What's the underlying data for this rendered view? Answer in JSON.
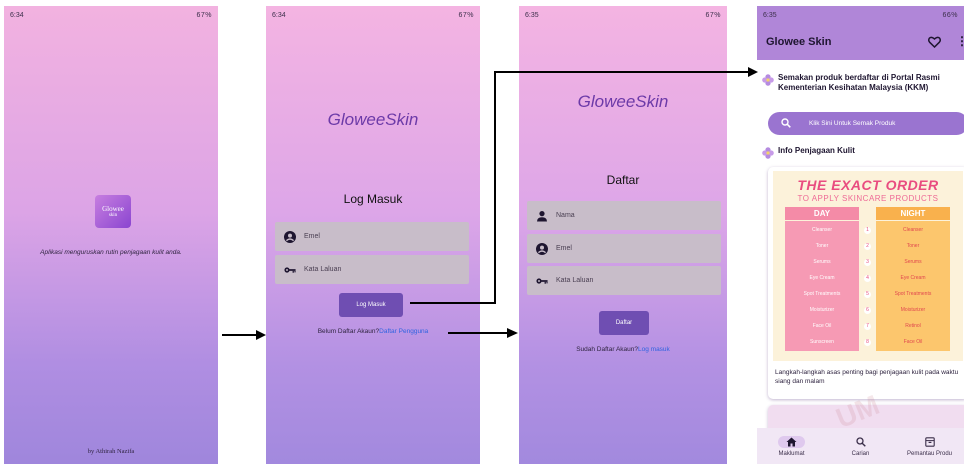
{
  "status": {
    "screen1": {
      "time": "6:34",
      "right": "67%"
    },
    "screen2": {
      "time": "6:34",
      "right": "67%"
    },
    "screen3": {
      "time": "6:35",
      "right": "67%"
    },
    "screen4": {
      "time": "6:35",
      "right": "66%"
    }
  },
  "splash": {
    "logo_line1": "Glowee",
    "logo_line2": "skin",
    "tagline": "Aplikasi menguruskan rutin penjagaan kulit anda.",
    "byline": "by Athirah Nazifa"
  },
  "login": {
    "brand": "GloweeSkin",
    "title": "Log Masuk",
    "email_placeholder": "Emel",
    "password_placeholder": "Kata Laluan",
    "button": "Log Masuk",
    "prompt": "Belum Daftar Akaun?",
    "link": "Daftar Pengguna"
  },
  "register": {
    "brand": "GloweeSkin",
    "title": "Daftar",
    "name_placeholder": "Nama",
    "email_placeholder": "Emel",
    "password_placeholder": "Kata Laluan",
    "button": "Daftar",
    "prompt": "Sudah Daftar Akaun?",
    "link": "Log masuk"
  },
  "home": {
    "app_title": "Glowee Skin",
    "kkm_heading": "Semakan produk berdaftar di Portal Rasmi Kementerian Kesihatan Malaysia (KKM)",
    "search_label": "Klik Sini Untuk Semak Produk",
    "info_heading": "Info Penjagaan Kulit",
    "poster": {
      "title": "THE EXACT ORDER",
      "subtitle": "TO APPLY SKINCARE PRODUCTS",
      "day": "DAY",
      "night": "NIGHT",
      "day_steps": [
        "Cleanser",
        "Toner",
        "Serums",
        "Eye Cream",
        "Spot Treatments",
        "Moisturizer",
        "Face Oil",
        "Sunscreen"
      ],
      "night_steps": [
        "Cleanser",
        "Toner",
        "Serums",
        "Eye Cream",
        "Spot Treatments",
        "Moisturizer",
        "Retinol",
        "Face Oil"
      ],
      "numbers": [
        "1",
        "2",
        "3",
        "4",
        "5",
        "6",
        "7",
        "8"
      ]
    },
    "info_caption": "Langkah-langkah asas penting bagi penjagaan kulit pada waktu siang dan malam",
    "nav": [
      "Maklumat",
      "Carian",
      "Pemantau Produ"
    ]
  },
  "watermark": "UM",
  "colors": {
    "primary": "#6f4eb2",
    "appbar": "#b086d8",
    "link": "#2f63e0",
    "poster_pink": "#e94c80",
    "poster_orange": "#f9b14d"
  }
}
